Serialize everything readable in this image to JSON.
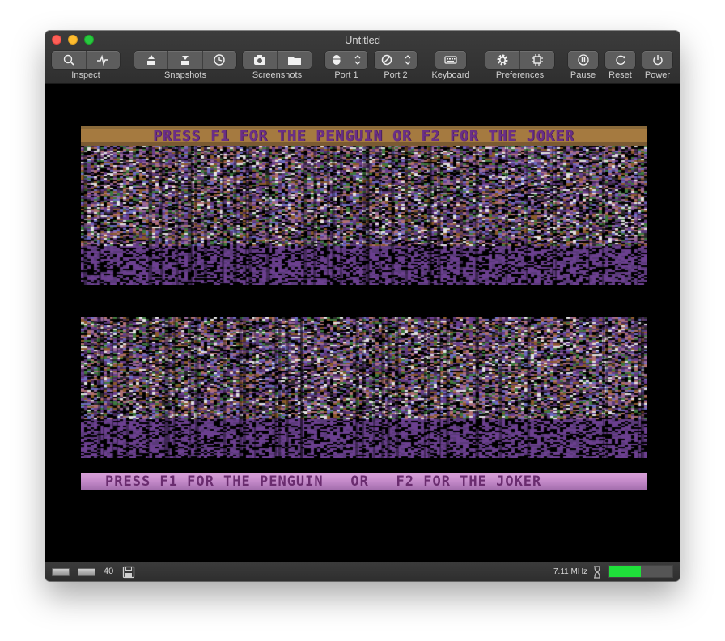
{
  "window": {
    "title": "Untitled"
  },
  "toolbar": {
    "inspect_label": "Inspect",
    "snapshots_label": "Snapshots",
    "screenshots_label": "Screenshots",
    "port1_label": "Port 1",
    "port2_label": "Port 2",
    "keyboard_label": "Keyboard",
    "preferences_label": "Preferences",
    "pause_label": "Pause",
    "reset_label": "Reset",
    "power_label": "Power"
  },
  "screen": {
    "top_banner": "PRESS F1 FOR THE PENGUIN  OR  F2 FOR THE JOKER",
    "bottom_banner": "PRESS F1 FOR THE PENGUIN   OR   F2 FOR THE JOKER",
    "top_banner_color": "#a57a40",
    "bottom_banner_color": "#c48ac9",
    "noise_colors": [
      "#6b3f8f",
      "#5a3a7a",
      "#6c6cc0",
      "#3e7a3e",
      "#8a5a2a",
      "#b07070",
      "#e0e0e0",
      "#2a2a2a",
      "#4a2a5a",
      "#9a6a9a"
    ]
  },
  "status": {
    "drive_track": "40",
    "clock_speed": "7.11 MHz",
    "speed_level": 0.5,
    "speed_color": "#1fe03a"
  }
}
